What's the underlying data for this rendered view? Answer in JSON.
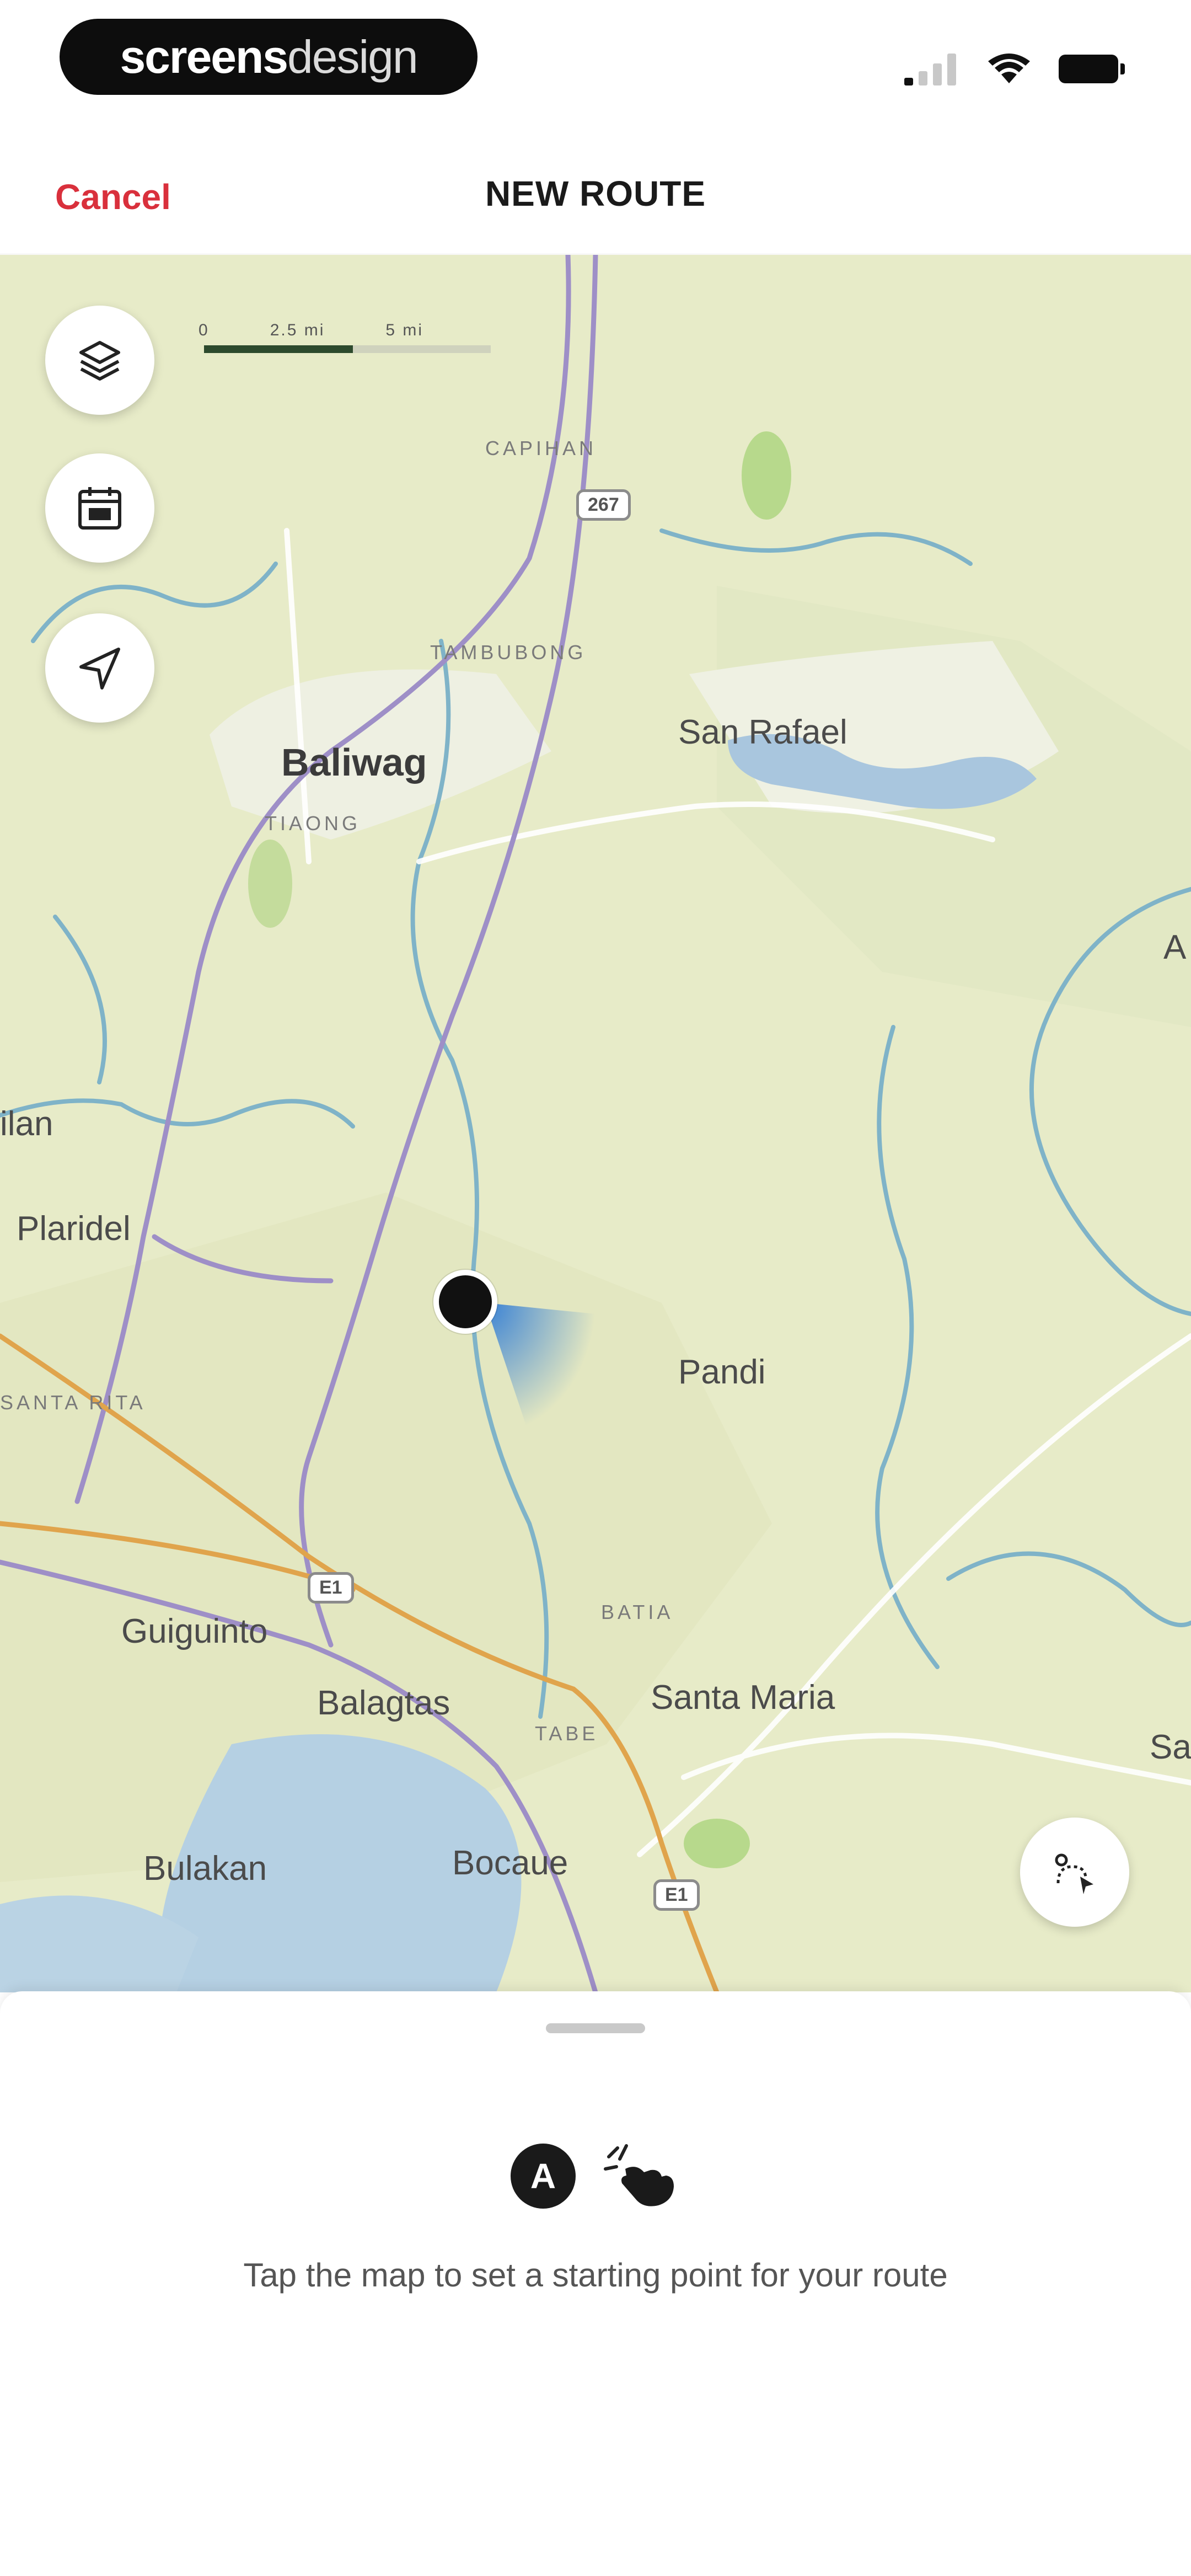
{
  "status_bar": {
    "brand_bold": "screens",
    "brand_light": "design"
  },
  "nav": {
    "cancel_label": "Cancel",
    "title": "NEW ROUTE"
  },
  "map": {
    "scale_labels": [
      "0",
      "2.5 mi",
      "5 mi"
    ],
    "labels": {
      "capihan": "CAPIHAN",
      "tambubong": "TAMBUBONG",
      "baliwag": "Baliwag",
      "tiaong": "TIAONG",
      "san_rafael": "San Rafael",
      "plaridel": "Plaridel",
      "pandi": "Pandi",
      "santa_rita": "SANTA RITA",
      "batia": "BATIA",
      "guiguinto": "Guiguinto",
      "balagtas": "Balagtas",
      "santa_maria": "Santa Maria",
      "bulakan": "Bulakan",
      "bocaue": "Bocaue",
      "tabe": "TABE",
      "edge_ilan": "ilan",
      "edge_a": "A",
      "edge_sa": "Sa"
    },
    "route_shields": {
      "r1": "267",
      "r2": "E1",
      "r3": "E1"
    },
    "fab_icons": [
      "layers-icon",
      "calendar-icon",
      "navigation-arrow-icon",
      "route-mode-icon"
    ]
  },
  "sheet": {
    "waypoint_badge": "A",
    "hint_text": "Tap the map to set a starting point for your route"
  },
  "colors": {
    "accent": "#d9303c",
    "map_land": "#e7ebc8",
    "map_water": "#a9c6de",
    "map_road_purple": "#9e8fc7",
    "map_road_orange": "#e0a44c",
    "map_river": "#7fb3c8"
  }
}
